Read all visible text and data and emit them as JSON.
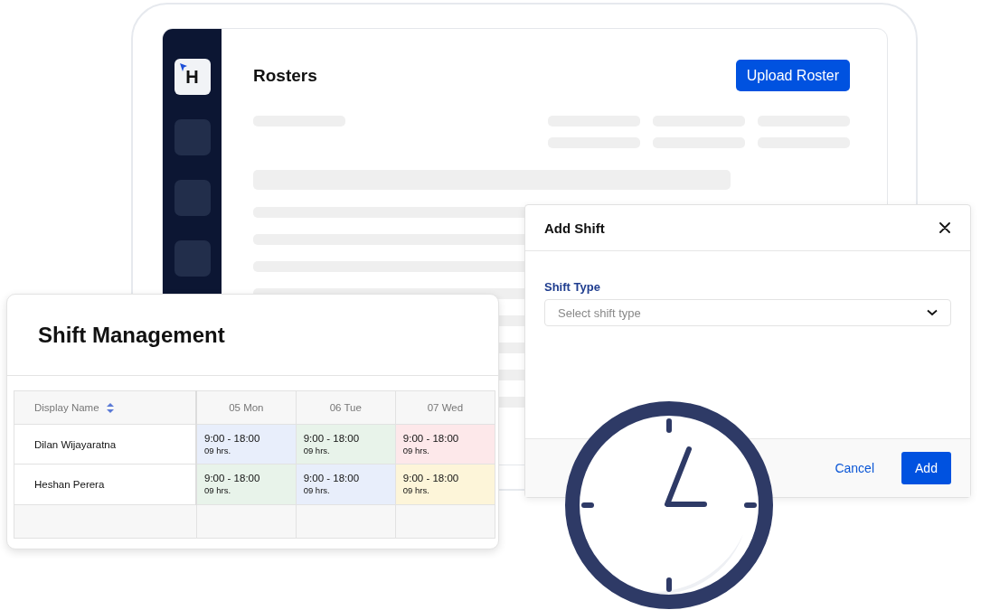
{
  "rosters": {
    "logo_letter": "H",
    "title": "Rosters",
    "upload_button": "Upload Roster"
  },
  "add_shift": {
    "title": "Add Shift",
    "field_label": "Shift Type",
    "placeholder": "Select shift type",
    "cancel_button": "Cancel",
    "add_button": "Add"
  },
  "shift_management": {
    "title": "Shift Management",
    "table": {
      "columns": [
        "Display Name",
        "05 Mon",
        "06 Tue",
        "07 Wed"
      ],
      "rows": [
        {
          "name": "Dilan Wijayaratna",
          "shifts": [
            {
              "time": "9:00 - 18:00",
              "hours": "09 hrs.",
              "color": "#e8eefb"
            },
            {
              "time": "9:00 - 18:00",
              "hours": "09 hrs.",
              "color": "#e8f3ea"
            },
            {
              "time": "9:00 - 18:00",
              "hours": "09 hrs.",
              "color": "#fde8ea"
            }
          ]
        },
        {
          "name": "Heshan Perera",
          "shifts": [
            {
              "time": "9:00 - 18:00",
              "hours": "09 hrs.",
              "color": "#e8f3ea"
            },
            {
              "time": "9:00 - 18:00",
              "hours": "09 hrs.",
              "color": "#e8eefb"
            },
            {
              "time": "9:00 - 18:00",
              "hours": "09 hrs.",
              "color": "#fdf5d9"
            }
          ]
        }
      ]
    }
  }
}
